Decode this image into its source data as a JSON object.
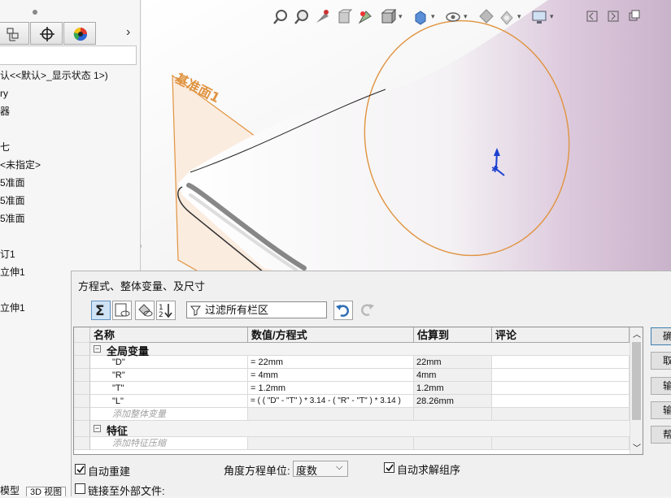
{
  "feature_tree": {
    "tabs": [
      "configuration-manager",
      "dimxpert-manager",
      "display-manager"
    ],
    "items": [
      {
        "label": "认<<默认>_显示状态 1>)"
      },
      {
        "label": "ry"
      },
      {
        "label": "器"
      },
      {
        "label": "七"
      },
      {
        "label": "<未指定>"
      },
      {
        "label": "5准面"
      },
      {
        "label": "5准面"
      },
      {
        "label": "5准面"
      },
      {
        "label": "订1"
      },
      {
        "label": "立伸1"
      },
      {
        "label": "立伸1"
      }
    ],
    "bottom_tabs": [
      "模型",
      "3D 视图"
    ]
  },
  "viewport": {
    "plane_label": "基准面1",
    "hud_icons": [
      "zoom-to-fit-icon",
      "zoom-area-icon",
      "previous-view-icon",
      "section-view-icon",
      "dynamic-annotation-icon",
      "view-orientation-icon",
      "display-style-icon",
      "hide-show-icon",
      "edit-appearance-icon",
      "apply-scene-icon",
      "view-settings-icon"
    ],
    "window_icons": [
      "restore-left-icon",
      "restore-right-icon",
      "tile-icon"
    ]
  },
  "dialog": {
    "title": "方程式、整体变量、及尺寸",
    "filter_placeholder": "过滤所有栏区",
    "columns": [
      "名称",
      "数值/方程式",
      "估算到",
      "评论"
    ],
    "global_group": "全局变量",
    "variables": [
      {
        "name": "\"D\"",
        "equation": "= 22mm",
        "evaluates": "22mm",
        "comment": ""
      },
      {
        "name": "\"R\"",
        "equation": "= 4mm",
        "evaluates": "4mm",
        "comment": ""
      },
      {
        "name": "\"T\"",
        "equation": "= 1.2mm",
        "evaluates": "1.2mm",
        "comment": ""
      },
      {
        "name": "\"L\"",
        "equation": "= ( ( \"D\" - \"T\" ) * 3.14 - ( \"R\" - \"T\" ) * 3.14 )",
        "evaluates": "28.26mm",
        "comment": ""
      }
    ],
    "add_global_placeholder": "添加整体变量",
    "feature_group": "特征",
    "add_feature_placeholder": "添加特征压缩",
    "auto_rebuild_label": "自动重建",
    "auto_rebuild_checked": true,
    "angle_unit_label": "角度方程单位:",
    "angle_unit_value": "度数",
    "auto_solve_label": "自动求解组序",
    "auto_solve_checked": true,
    "link_file_label": "链接至外部文件:",
    "link_file_checked": false,
    "side_buttons": [
      "确",
      "取",
      "输",
      "输",
      "帮"
    ]
  }
}
